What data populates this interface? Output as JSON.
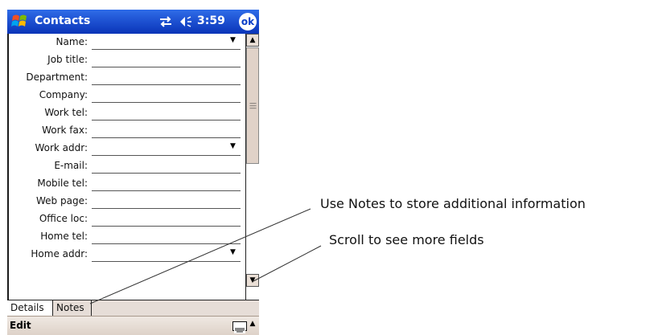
{
  "titlebar": {
    "app_title": "Contacts",
    "clock": "3:59",
    "ok_label": "ok",
    "icons": [
      "windows-start-icon",
      "connectivity-icon",
      "volume-icon"
    ]
  },
  "form": {
    "fields": [
      {
        "label": "Name:",
        "dropdown": true
      },
      {
        "label": "Job title:",
        "dropdown": false
      },
      {
        "label": "Department:",
        "dropdown": false
      },
      {
        "label": "Company:",
        "dropdown": false
      },
      {
        "label": "Work tel:",
        "dropdown": false
      },
      {
        "label": "Work fax:",
        "dropdown": false
      },
      {
        "label": "Work addr:",
        "dropdown": true
      },
      {
        "label": "E-mail:",
        "dropdown": false
      },
      {
        "label": "Mobile tel:",
        "dropdown": false
      },
      {
        "label": "Web page:",
        "dropdown": false
      },
      {
        "label": "Office loc:",
        "dropdown": false
      },
      {
        "label": "Home tel:",
        "dropdown": false
      },
      {
        "label": "Home addr:",
        "dropdown": true
      }
    ]
  },
  "tabs": [
    {
      "label": "Details",
      "active": true
    },
    {
      "label": "Notes",
      "active": false
    }
  ],
  "menubar": {
    "edit_label": "Edit",
    "icons": [
      "keyboard-icon",
      "input-arrow-icon"
    ]
  },
  "callouts": {
    "notes": "Use Notes to store additional information",
    "scroll": "Scroll to see more fields"
  },
  "colors": {
    "titlebar": "#0a3ec8",
    "chrome": "#e6ddd7"
  }
}
